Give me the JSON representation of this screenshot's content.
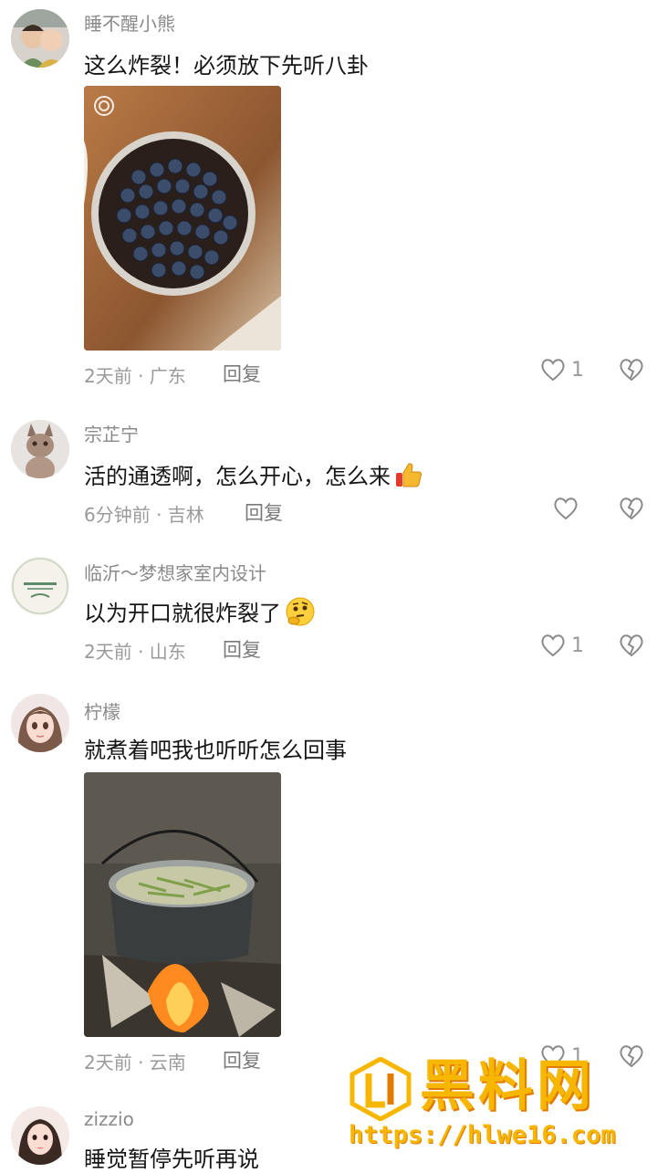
{
  "comments": [
    {
      "username": "睡不醒小熊",
      "text": "这么炸裂！必须放下先听八卦",
      "time_location": "2天前 · 广东",
      "reply_label": "回复",
      "like_count": "1",
      "image": "blueberry-cake-photo"
    },
    {
      "username": "宗芷宁",
      "text": "活的通透啊，怎么开心，怎么来",
      "emoji": "thumbs-up-icon",
      "time_location": "6分钟前 · 吉林",
      "reply_label": "回复",
      "like_count": ""
    },
    {
      "username": "临沂～梦想家室内设计",
      "text": "以为开口就很炸裂了",
      "emoji": "thinking-face-icon",
      "time_location": "2天前 · 山东",
      "reply_label": "回复",
      "like_count": "1"
    },
    {
      "username": "柠檬",
      "text": "就煮着吧我也听听怎么回事",
      "time_location": "2天前 · 云南",
      "reply_label": "回复",
      "like_count": "1",
      "image": "cooking-pot-fire-photo"
    },
    {
      "username": "zizzio",
      "text": "睡觉暂停先听再说"
    }
  ],
  "watermark": {
    "title": "黑料网",
    "url": "https://hlwe16.com"
  },
  "colors": {
    "text_primary": "#161616",
    "text_secondary": "#9a9a9a",
    "watermark": "#f7b600"
  }
}
